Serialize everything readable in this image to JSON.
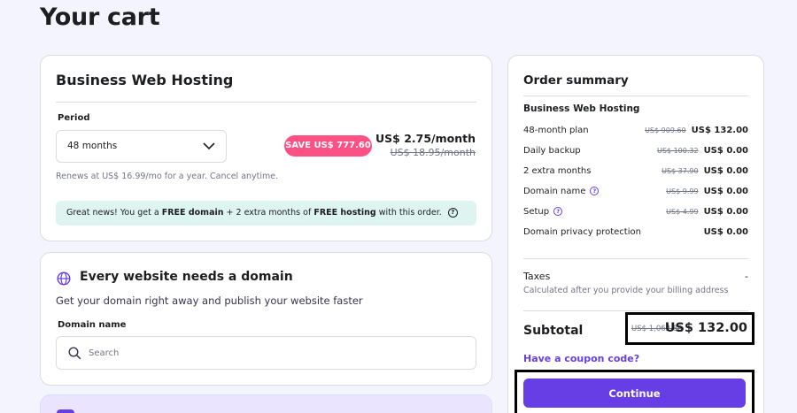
{
  "page": {
    "title": "Your cart"
  },
  "hosting_card": {
    "title": "Business Web Hosting",
    "period_label": "Period",
    "period_selected": "48 months",
    "save_badge": "SAVE US$ 777.60",
    "price_now": "US$ 2.75/month",
    "price_old": "US$ 18.95/month",
    "renew_note": "Renews at US$ 16.99/mo for a year. Cancel anytime.",
    "promo": {
      "part1": "Great news! You get a ",
      "bold1": "FREE domain",
      "part2": " + 2 extra months of ",
      "bold2": "FREE hosting",
      "part3": " with this order."
    }
  },
  "domain_card": {
    "title": "Every website needs a domain",
    "subtitle": "Get your domain right away and publish your website faster",
    "field_label": "Domain name",
    "search_placeholder": "Search"
  },
  "summary": {
    "title": "Order summary",
    "product": "Business Web Hosting",
    "items": [
      {
        "label": "48-month plan",
        "old": "US$ 909.60",
        "new": "US$ 132.00",
        "help": false
      },
      {
        "label": "Daily backup",
        "old": "US$ 100.32",
        "new": "US$ 0.00",
        "help": false
      },
      {
        "label": "2 extra months",
        "old": "US$ 37.90",
        "new": "US$ 0.00",
        "help": false
      },
      {
        "label": "Domain name",
        "old": "US$ 9.99",
        "new": "US$ 0.00",
        "help": true
      },
      {
        "label": "Setup",
        "old": "US$ 4.99",
        "new": "US$ 0.00",
        "help": true
      },
      {
        "label": "Domain privacy protection",
        "old": "",
        "new": "US$ 0.00",
        "help": false
      }
    ],
    "taxes_label": "Taxes",
    "taxes_value": "-",
    "taxes_note": "Calculated after you provide your billing address",
    "subtotal_label": "Subtotal",
    "subtotal_old": "US$ 1,062.80",
    "subtotal_new": "US$ 132.00",
    "coupon_link": "Have a coupon code?",
    "continue_label": "Continue"
  },
  "colors": {
    "accent": "#673de6",
    "badge": "#fc5185",
    "promo_bg": "#def4f0",
    "page_bg": "#f4f4ff"
  }
}
